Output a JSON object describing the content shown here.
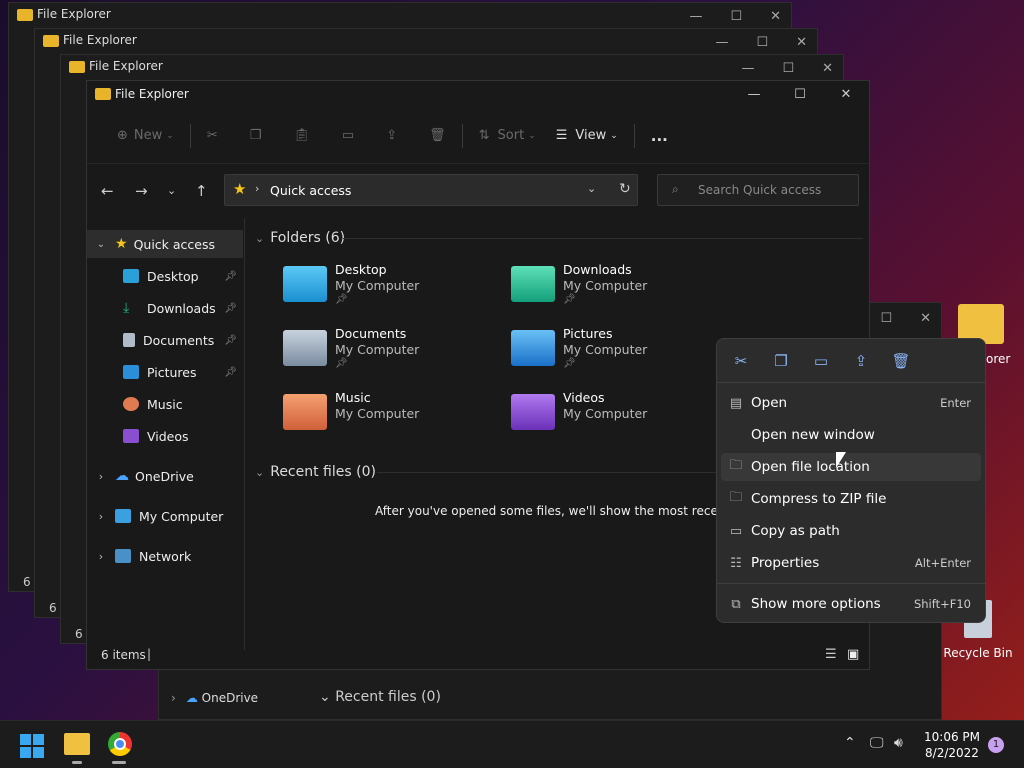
{
  "window": {
    "title": "File Explorer"
  },
  "toolbar": {
    "new": "New",
    "sort": "Sort",
    "view": "View",
    "more": "..."
  },
  "address": {
    "path": "Quick access"
  },
  "search": {
    "placeholder": "Search Quick access"
  },
  "nav": [
    {
      "label": "Quick access",
      "icon": "star-icon"
    },
    {
      "label": "Desktop",
      "icon": "desktop-icon"
    },
    {
      "label": "Downloads",
      "icon": "download-icon"
    },
    {
      "label": "Documents",
      "icon": "document-icon"
    },
    {
      "label": "Pictures",
      "icon": "picture-icon"
    },
    {
      "label": "Music",
      "icon": "music-icon"
    },
    {
      "label": "Videos",
      "icon": "video-icon"
    },
    {
      "label": "OneDrive",
      "icon": "cloud-icon"
    },
    {
      "label": "My Computer",
      "icon": "computer-icon"
    },
    {
      "label": "Network",
      "icon": "network-icon"
    }
  ],
  "folders_header": "Folders (6)",
  "folders": [
    {
      "name": "Desktop",
      "sub": "My Computer",
      "color": "#2a9fd8"
    },
    {
      "name": "Downloads",
      "sub": "My Computer",
      "color": "#1fb48a"
    },
    {
      "name": "Documents",
      "sub": "My Computer",
      "color": "#8a9bb0"
    },
    {
      "name": "Pictures",
      "sub": "My Computer",
      "color": "#2a8fd8"
    },
    {
      "name": "Music",
      "sub": "My Computer",
      "color": "#e07a50"
    },
    {
      "name": "Videos",
      "sub": "My Computer",
      "color": "#8a4fd0"
    }
  ],
  "recent_header": "Recent files (0)",
  "recent_empty": "After you've opened some files, we'll show the most recent ones",
  "status": {
    "items": "6 items"
  },
  "context_menu": {
    "items": [
      {
        "label": "Open",
        "shortcut": "Enter"
      },
      {
        "label": "Open new window",
        "shortcut": ""
      },
      {
        "label": "Open file location",
        "shortcut": ""
      },
      {
        "label": "Compress to ZIP file",
        "shortcut": ""
      },
      {
        "label": "Copy as path",
        "shortcut": ""
      },
      {
        "label": "Properties",
        "shortcut": "Alt+Enter"
      },
      {
        "label": "Show more options",
        "shortcut": "Shift+F10"
      }
    ]
  },
  "bg": {
    "items_count": "6 i",
    "onedrive": "OneDrive",
    "recent": "Recent files (0)"
  },
  "desktop": {
    "recycle_bin": "Recycle Bin",
    "explorer_partial": "orer"
  },
  "taskbar": {
    "time": "10:06 PM",
    "date": "8/2/2022",
    "badge": "1"
  }
}
